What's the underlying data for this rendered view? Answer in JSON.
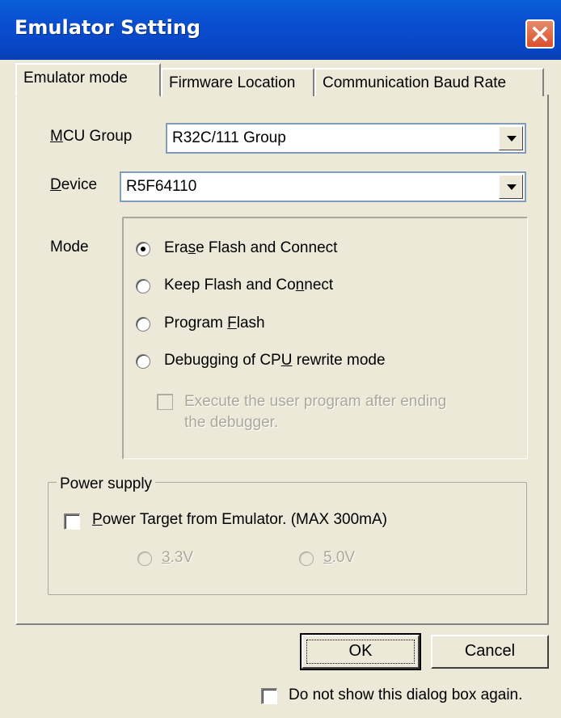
{
  "window": {
    "title": "Emulator Setting"
  },
  "tabs": [
    {
      "label": "Emulator mode"
    },
    {
      "label": "Firmware Location"
    },
    {
      "label": "Communication Baud Rate"
    }
  ],
  "mcu_group": {
    "label_key": "M",
    "label_rest": "CU Group",
    "value": "R32C/111 Group"
  },
  "device": {
    "label_key": "D",
    "label_rest": "evice",
    "value": "R5F64110"
  },
  "mode": {
    "label": "Mode",
    "options": [
      {
        "pre": "Era",
        "key": "s",
        "post": "e Flash and Connect",
        "checked": true
      },
      {
        "pre": "Keep Flash and Co",
        "key": "n",
        "post": "nect",
        "checked": false
      },
      {
        "pre": "Program ",
        "key": "F",
        "post": "lash",
        "checked": false
      },
      {
        "pre": "Debugging of CP",
        "key": "U",
        "post": " rewrite mode",
        "checked": false
      }
    ],
    "sub_option": {
      "line1": "Execute the user program after ending",
      "line2": "the debugger.",
      "checked": false,
      "enabled": false
    }
  },
  "power": {
    "group_label": "Power supply",
    "checkbox": {
      "key": "P",
      "rest": "ower Target from Emulator. (MAX 300mA)",
      "checked": false
    },
    "v33": {
      "key": "3",
      "rest": ".3V"
    },
    "v50": {
      "key": "5",
      "rest": ".0V"
    }
  },
  "buttons": {
    "ok": "OK",
    "cancel": "Cancel"
  },
  "footer": {
    "dont_show": "Do not show this dialog box again."
  }
}
